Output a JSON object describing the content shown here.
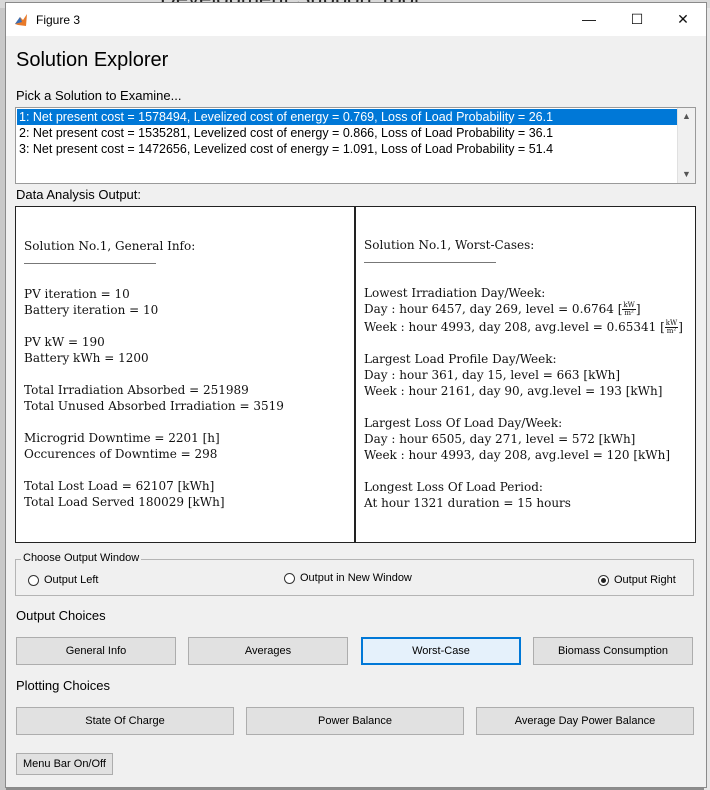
{
  "background": {
    "partial_text": "Development Support Tool"
  },
  "window": {
    "title": "Figure 3",
    "minimize_glyph": "—",
    "maximize_glyph": "☐",
    "close_glyph": "✕"
  },
  "heading": "Solution Explorer",
  "pick_label": "Pick a Solution to Examine...",
  "solutions": [
    "1: Net present cost = 1578494, Levelized cost of energy = 0.769, Loss of Load Probability = 26.1",
    "2: Net present cost = 1535281, Levelized cost of energy = 0.866, Loss of Load Probability = 36.1",
    "3: Net present cost = 1472656, Levelized cost of energy = 1.091, Loss of Load Probability = 51.4"
  ],
  "selected_solution_index": 0,
  "data_analysis_label": "Data Analysis Output:",
  "left_panel": {
    "title": "Solution No.1, General Info:",
    "pv_iteration": "PV iteration = 10",
    "battery_iteration": "Battery iteration = 10",
    "pv_kw": "PV kW = 190",
    "battery_kwh": "Battery kWh = 1200",
    "total_irradiation": "Total Irradiation Absorbed = 251989",
    "total_unused": "Total Unused Absorbed Irradiation = 3519",
    "downtime": "Microgrid Downtime = 2201 [h]",
    "occurences": "Occurences of Downtime = 298",
    "lost_load": "Total Lost Load = 62107 [kWh]",
    "load_served": "Total Load Served 180029 [kWh]"
  },
  "right_panel": {
    "title": "Solution No.1, Worst-Cases:",
    "lowest_irr_title": "Lowest Irradiation Day/Week:",
    "lowest_irr_day": "Day : hour 6457, day 269, level = 0.6764",
    "lowest_irr_week": "Week : hour 4993, day 208, avg.level = 0.65341",
    "irr_unit_num": "kW",
    "irr_unit_den": "m²",
    "largest_load_title": "Largest Load Profile Day/Week:",
    "largest_load_day": "Day : hour 361, day 15, level = 663 [kWh]",
    "largest_load_week": "Week : hour 2161, day 90, avg.level = 193 [kWh]",
    "largest_lol_title": "Largest Loss Of Load Day/Week:",
    "largest_lol_day": "Day : hour 6505, day 271, level = 572 [kWh]",
    "largest_lol_week": "Week : hour 4993, day 208, avg.level = 120 [kWh]",
    "longest_title": "Longest Loss Of Load Period:",
    "longest_value": "At hour 1321 duration = 15 hours"
  },
  "output_window": {
    "title": "Choose Output Window",
    "options": [
      "Output Left",
      "Output in New Window",
      "Output Right"
    ],
    "selected": "Output Right"
  },
  "output_choices": {
    "label": "Output Choices",
    "buttons": [
      "General Info",
      "Averages",
      "Worst-Case",
      "Biomass Consumption"
    ],
    "active": "Worst-Case"
  },
  "plotting_choices": {
    "label": "Plotting Choices",
    "buttons": [
      "State Of Charge",
      "Power Balance",
      "Average Day Power Balance"
    ]
  },
  "menu_bar_button": "Menu Bar On/Off",
  "colors": {
    "selection": "#0078d7",
    "window_bg": "#f0f0f0",
    "button_bg": "#e1e1e1"
  }
}
